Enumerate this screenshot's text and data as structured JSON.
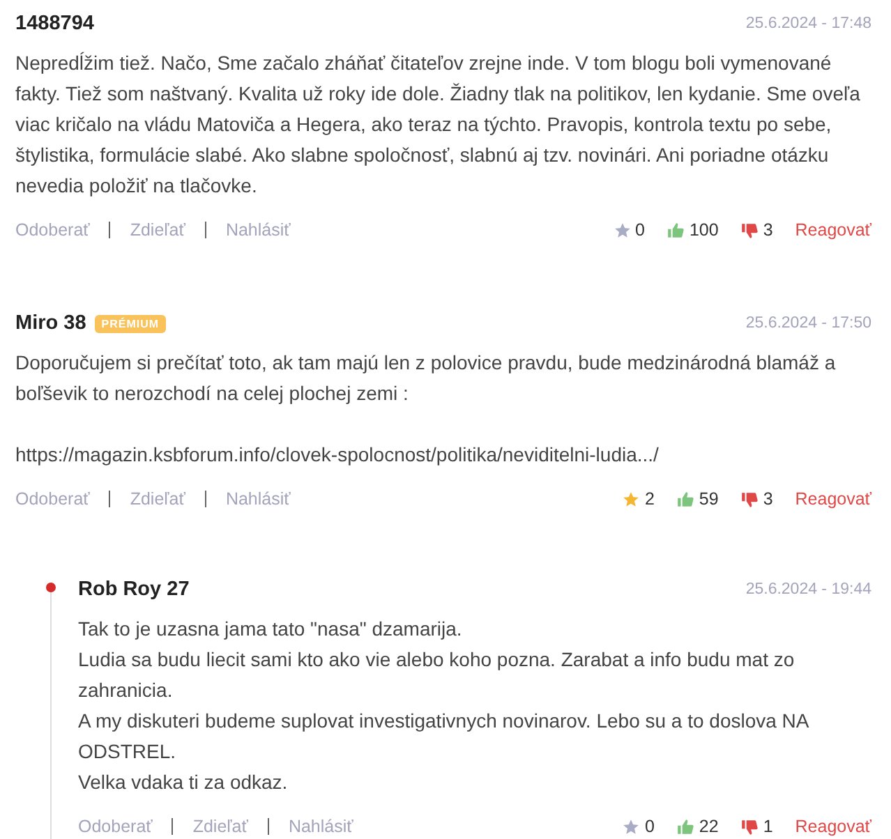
{
  "comments": [
    {
      "author": "1488794",
      "date": "25.6.2024 - 17:48",
      "paragraphs": [
        [
          "Nepredĺžim tiež. Načo, Sme začalo zháňať čitateľov zrejne inde. V tom blogu boli vymenované fakty. Tiež som naštvaný. Kvalita už roky ide dole. Žiadny tlak na politikov, len kydanie. Sme oveľa viac kričalo na vládu Matoviča a Hegera, ako teraz na týchto. Pravopis, kontrola textu po sebe, štylistika, formulácie slabé. Ako slabne spoločnosť, slabnú aj tzv. novinári. Ani poriadne otázku nevedia položiť na tlačovke."
        ]
      ],
      "actions": [
        "Odoberať",
        "Zdieľať",
        "Nahlásiť"
      ],
      "starred": false,
      "stars_count": "0",
      "likes": "100",
      "dislikes": "3",
      "reply": "Reagovať"
    },
    {
      "author": "Miro 38",
      "badge": "PRÉMIUM",
      "date": "25.6.2024 - 17:50",
      "paragraphs": [
        [
          "Doporučujem si prečítať toto, ak tam majú len z polovice pravdu, bude medzinárodná blamáž a boľševik to nerozchodí na celej plochej zemi :"
        ],
        [
          "https://magazin.ksbforum.info/clovek-spolocnost/politika/neviditelni-ludia.../"
        ]
      ],
      "actions": [
        "Odoberať",
        "Zdieľať",
        "Nahlásiť"
      ],
      "starred": true,
      "stars_count": "2",
      "likes": "59",
      "dislikes": "3",
      "reply": "Reagovať",
      "children": [
        {
          "author": "Rob Roy 27",
          "date": "25.6.2024 - 19:44",
          "paragraphs": [
            [
              "Tak to je uzasna jama tato \"nasa\" dzamarija.",
              "Ludia sa budu liecit sami kto ako vie alebo koho pozna. Zarabat a info budu mat zo zahranicia.",
              "A my diskuteri budeme suplovat investigativnych novinarov. Lebo su a to doslova NA ODSTREL.",
              "Velka vdaka ti za odkaz."
            ]
          ],
          "actions": [
            "Odoberať",
            "Zdieľať",
            "Nahlásiť"
          ],
          "starred": false,
          "stars_count": "0",
          "likes": "22",
          "dislikes": "1",
          "reply": "Reagovať"
        }
      ]
    }
  ]
}
